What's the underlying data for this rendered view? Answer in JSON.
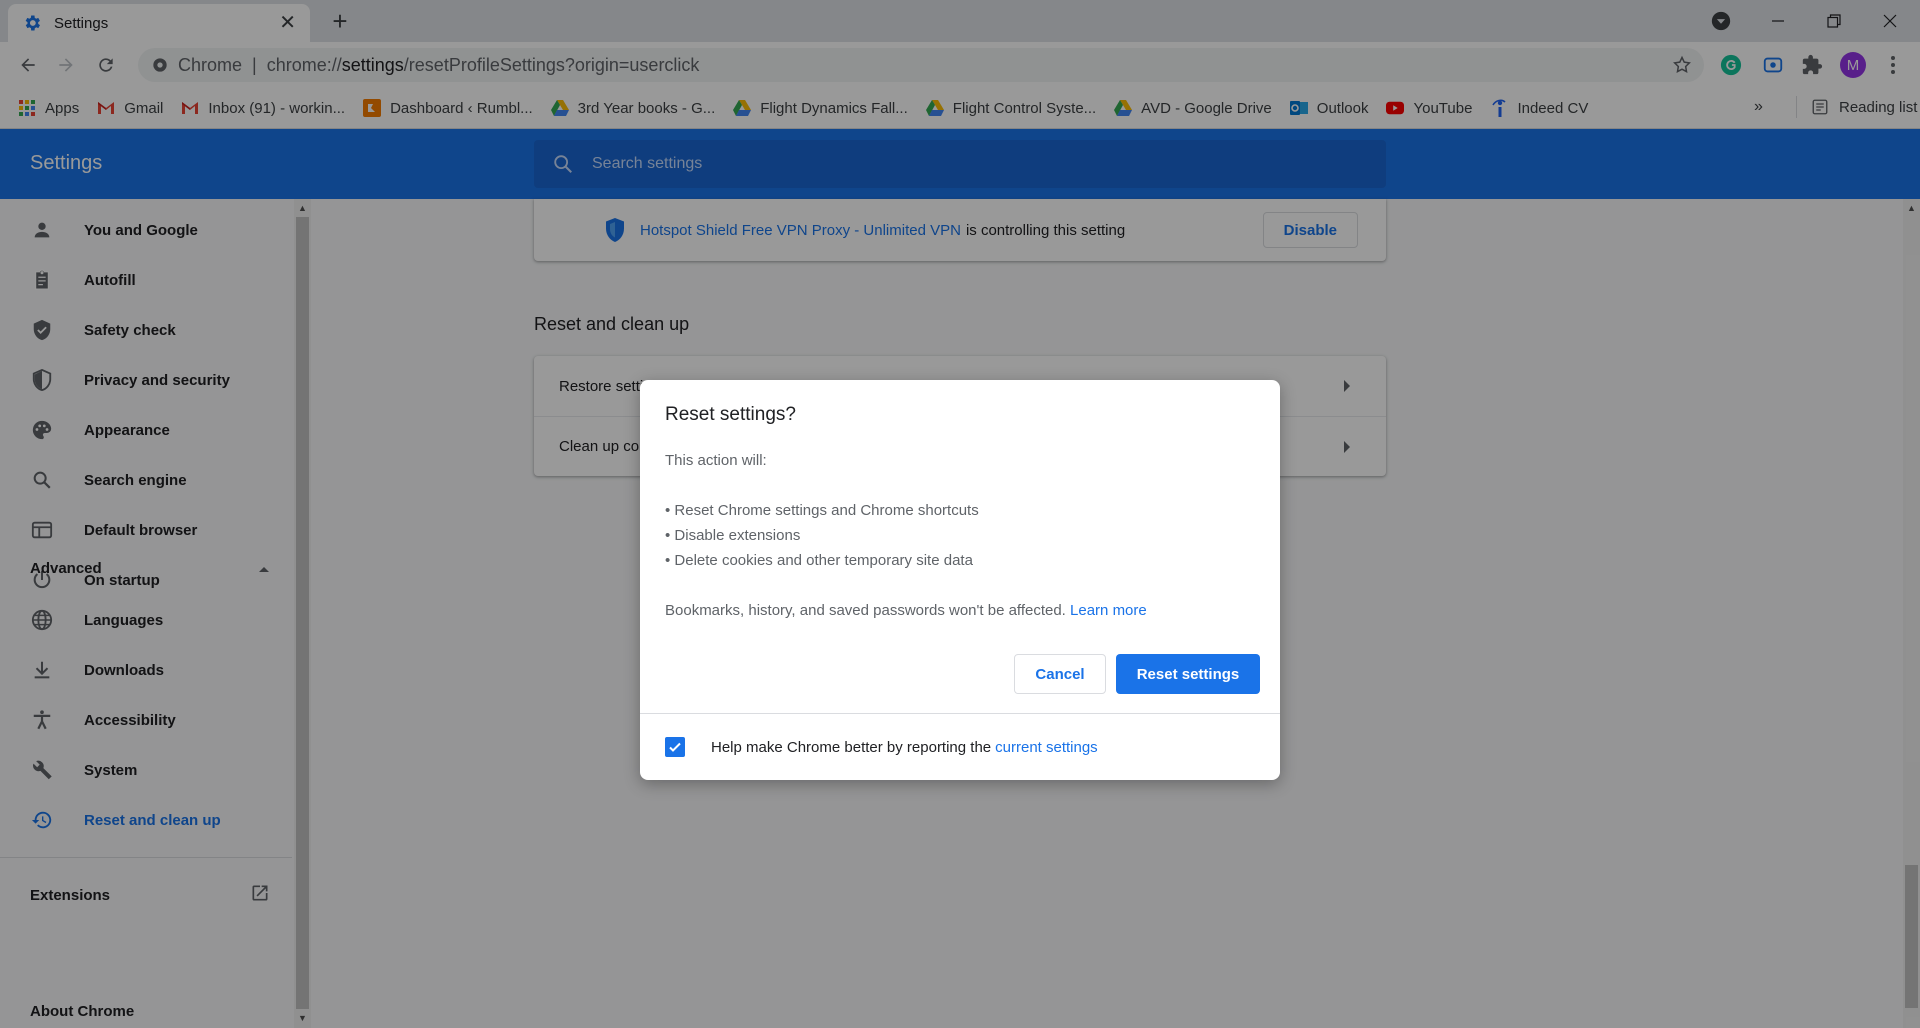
{
  "tab": {
    "title": "Settings"
  },
  "omnibox": {
    "scheme": "Chrome",
    "separator": "|",
    "url_prefix": "chrome://",
    "url_host": "settings",
    "url_path": "/resetProfileSettings?origin=userclick"
  },
  "profile": {
    "initial": "M"
  },
  "bookmarks": [
    {
      "label": "Apps",
      "icon": "apps-grid-icon"
    },
    {
      "label": "Gmail",
      "icon": "gmail-icon"
    },
    {
      "label": "Inbox (91) - workin...",
      "icon": "gmail-icon"
    },
    {
      "label": "Dashboard ‹ Rumbl...",
      "icon": "dashboard-icon"
    },
    {
      "label": "3rd Year books - G...",
      "icon": "google-drive-icon"
    },
    {
      "label": "Flight Dynamics Fall...",
      "icon": "google-drive-icon"
    },
    {
      "label": "Flight Control Syste...",
      "icon": "google-drive-icon"
    },
    {
      "label": "AVD - Google Drive",
      "icon": "google-drive-icon"
    },
    {
      "label": "Outlook",
      "icon": "outlook-icon"
    },
    {
      "label": "YouTube",
      "icon": "youtube-icon"
    },
    {
      "label": "Indeed CV",
      "icon": "indeed-icon"
    }
  ],
  "bookmarks_overflow": "»",
  "reading_list": "Reading list",
  "settings": {
    "app_title": "Settings",
    "search_placeholder": "Search settings",
    "nav": [
      {
        "label": "You and Google",
        "icon": "person-icon"
      },
      {
        "label": "Autofill",
        "icon": "clipboard-icon"
      },
      {
        "label": "Safety check",
        "icon": "shield-check-icon"
      },
      {
        "label": "Privacy and security",
        "icon": "shield-half-icon"
      },
      {
        "label": "Appearance",
        "icon": "palette-icon"
      },
      {
        "label": "Search engine",
        "icon": "search-icon"
      },
      {
        "label": "Default browser",
        "icon": "browser-window-icon"
      },
      {
        "label": "On startup",
        "icon": "power-icon"
      }
    ],
    "advanced_label": "Advanced",
    "advanced_nav": [
      {
        "label": "Languages",
        "icon": "globe-icon"
      },
      {
        "label": "Downloads",
        "icon": "download-icon"
      },
      {
        "label": "Accessibility",
        "icon": "accessibility-icon"
      },
      {
        "label": "System",
        "icon": "wrench-icon"
      },
      {
        "label": "Reset and clean up",
        "icon": "history-reset-icon"
      }
    ],
    "extensions_label": "Extensions",
    "about_label": "About Chrome",
    "extension_notice": {
      "extension_name": "Hotspot Shield Free VPN Proxy - Unlimited VPN",
      "suffix": "is controlling this setting",
      "disable_label": "Disable"
    },
    "section_title": "Reset and clean up",
    "rows": [
      "Restore settings to their original defaults",
      "Clean up computer"
    ]
  },
  "dialog": {
    "title": "Reset settings?",
    "intro": "This action will:",
    "bullets": [
      "• Reset Chrome settings and Chrome shortcuts",
      "• Disable extensions",
      "• Delete cookies and other temporary site data"
    ],
    "note": "Bookmarks, history, and saved passwords won't be affected.",
    "learn_more": "Learn more",
    "cancel_label": "Cancel",
    "confirm_label": "Reset settings",
    "footer_text": "Help make Chrome better by reporting the",
    "footer_link": "current settings",
    "footer_checked": true
  },
  "colors": {
    "accent": "#1a73e8",
    "header": "#1a73e8",
    "avatar": "#9334e6"
  }
}
